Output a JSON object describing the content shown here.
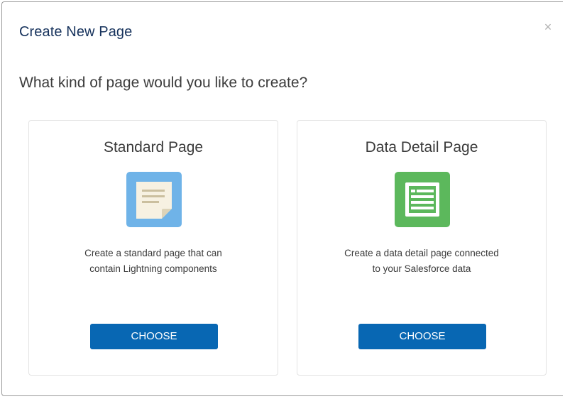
{
  "dialog": {
    "title": "Create New Page",
    "close_glyph": "×",
    "question": "What kind of page would you like to create?"
  },
  "cards": [
    {
      "title": "Standard Page",
      "description_line1": "Create a standard page that can",
      "description_line2": "contain Lightning components",
      "button_label": "CHOOSE",
      "icon": "standard-page-icon",
      "icon_color": "#6fb3e8"
    },
    {
      "title": "Data Detail Page",
      "description_line1": "Create a data detail page connected",
      "description_line2": "to your Salesforce data",
      "button_label": "CHOOSE",
      "icon": "data-detail-page-icon",
      "icon_color": "#5cb85c"
    }
  ],
  "colors": {
    "button": "#0867b3",
    "title_text": "#16325c"
  }
}
